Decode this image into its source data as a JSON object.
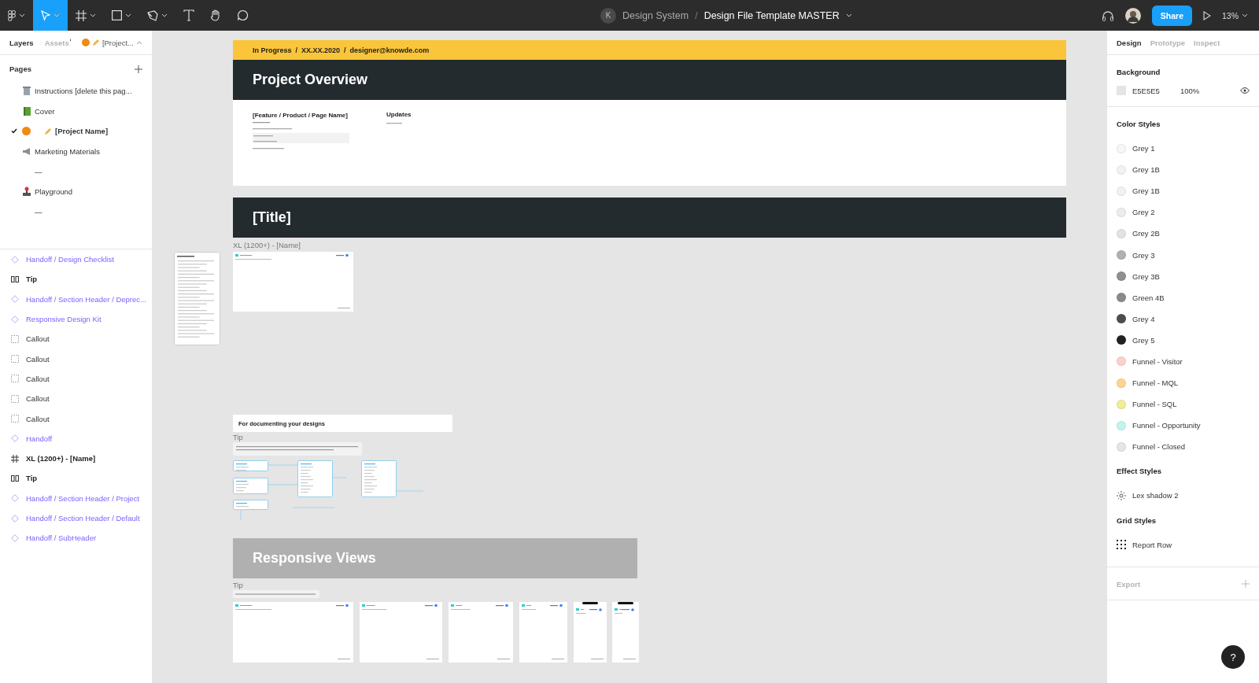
{
  "toolbar": {
    "avatar_initial": "K",
    "project": "Design System",
    "separator": "/",
    "file_name": "Design File Template MASTER",
    "share": "Share",
    "zoom": "13%"
  },
  "left_panel": {
    "tabs": [
      {
        "label": "Layers",
        "selected": true
      },
      {
        "label": "Assets",
        "selected": false
      }
    ],
    "page_selector": "[Project...",
    "pages_title": "Pages",
    "pages": [
      {
        "kind": "page",
        "label": "Instructions [delete this pag...",
        "selected": false
      },
      {
        "kind": "page",
        "label": "Cover",
        "selected": false
      },
      {
        "kind": "page",
        "label": "[Project Name]",
        "selected": true
      },
      {
        "kind": "page",
        "label": "Marketing Materials",
        "selected": false
      },
      {
        "kind": "separator",
        "label": "—"
      },
      {
        "kind": "page",
        "label": "Playground",
        "selected": false
      },
      {
        "kind": "separator",
        "label": "—"
      }
    ],
    "layers": [
      {
        "kind": "component",
        "label": "Handoff / Design Checklist"
      },
      {
        "kind": "autolayout",
        "label": "Tip"
      },
      {
        "kind": "component",
        "label": "Handoff / Section Header / Deprec..."
      },
      {
        "kind": "component",
        "label": "Responsive Design Kit"
      },
      {
        "kind": "callout",
        "label": "Callout"
      },
      {
        "kind": "callout",
        "label": "Callout"
      },
      {
        "kind": "callout",
        "label": "Callout"
      },
      {
        "kind": "callout",
        "label": "Callout"
      },
      {
        "kind": "callout",
        "label": "Callout"
      },
      {
        "kind": "component",
        "label": "Handoff"
      },
      {
        "kind": "frame",
        "label": "XL (1200+) - [Name]"
      },
      {
        "kind": "autolayout",
        "label": "Tip"
      },
      {
        "kind": "component",
        "label": "Handoff / Section Header / Project"
      },
      {
        "kind": "component",
        "label": "Handoff / Section Header / Default"
      },
      {
        "kind": "component",
        "label": "Handoff / SubHeader"
      }
    ]
  },
  "canvas": {
    "status_line": "In Progress  /  XX.XX.2020  /  designer@knowde.com",
    "overview_title": "Project Overview",
    "feature_title": "[Feature / Product / Page Name]",
    "updates_title": "Updates",
    "section_title": "[Title]",
    "frame_label": "XL (1200+) - [Name]",
    "doc_title": "For documenting your designs",
    "tips": [
      "Tip",
      "Tip"
    ],
    "responsive_title": "Responsive Views"
  },
  "right_panel": {
    "tabs": [
      {
        "label": "Design",
        "selected": true
      },
      {
        "label": "Prototype",
        "selected": false
      },
      {
        "label": "Inspect",
        "selected": false
      }
    ],
    "background": {
      "title": "Background",
      "hex": "E5E5E5",
      "opacity": "100%",
      "color": "#e5e5e5"
    },
    "color_styles_title": "Color Styles",
    "color_styles": [
      {
        "name": "Grey 1",
        "color": "#f7f7f7"
      },
      {
        "name": "Grey 1B",
        "color": "#f2f2f2"
      },
      {
        "name": "Grey 1B",
        "color": "#f2f2f2"
      },
      {
        "name": "Grey 2",
        "color": "#ececec"
      },
      {
        "name": "Grey 2B",
        "color": "#e3e3e3"
      },
      {
        "name": "Grey 3",
        "color": "#b0b0b0"
      },
      {
        "name": "Grey 3B",
        "color": "#8f8f8f"
      },
      {
        "name": "Green 4B",
        "color": "#8a8a8a"
      },
      {
        "name": "Grey 4",
        "color": "#4d4d4d"
      },
      {
        "name": "Grey 5",
        "color": "#222222"
      },
      {
        "name": "Funnel - Visitor",
        "color": "#fdd0d0"
      },
      {
        "name": "Funnel - MQL",
        "color": "#fdd58f"
      },
      {
        "name": "Funnel - SQL",
        "color": "#f1ec97"
      },
      {
        "name": "Funnel - Opportunity",
        "color": "#c2f3ef"
      },
      {
        "name": "Funnel - Closed",
        "color": "#e5e5e5"
      }
    ],
    "effect_styles_title": "Effect Styles",
    "effect_styles": [
      "Lex shadow 2"
    ],
    "grid_styles_title": "Grid Styles",
    "grid_styles": [
      "Report Row"
    ],
    "export_title": "Export",
    "help": "?"
  }
}
